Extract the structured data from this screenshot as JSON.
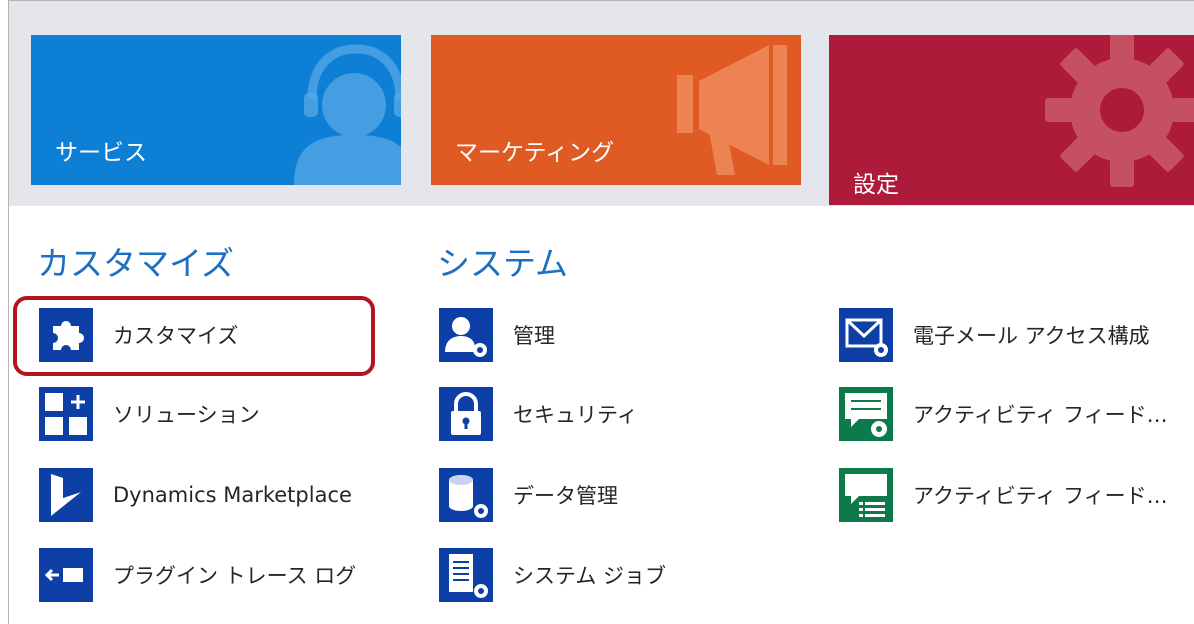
{
  "tiles": [
    {
      "label": "サービス",
      "icon": "headset-person-icon",
      "color": "#0d80d6"
    },
    {
      "label": "マーケティング",
      "icon": "megaphone-icon",
      "color": "#e05a24"
    },
    {
      "label": "設定",
      "icon": "gear-icon",
      "color": "#ae1a3a"
    }
  ],
  "sections": {
    "customize": {
      "title": "カスタマイズ",
      "items": [
        {
          "label": "カスタマイズ",
          "icon": "puzzle-icon",
          "highlighted": true
        },
        {
          "label": "ソリューション",
          "icon": "solution-blocks-icon"
        },
        {
          "label": "Dynamics Marketplace",
          "icon": "dynamics-logo-icon"
        },
        {
          "label": "プラグイン トレース ログ",
          "icon": "plugin-trace-icon"
        }
      ]
    },
    "system": {
      "title": "システム",
      "items": [
        {
          "label": "管理",
          "icon": "admin-user-gear-icon"
        },
        {
          "label": "セキュリティ",
          "icon": "lock-icon"
        },
        {
          "label": "データ管理",
          "icon": "database-gear-icon"
        },
        {
          "label": "システム ジョブ",
          "icon": "document-gear-icon"
        }
      ]
    },
    "system_col2": {
      "items": [
        {
          "label": "電子メール アクセス構成",
          "icon": "email-gear-icon"
        },
        {
          "label": "アクティビティ フィード…",
          "icon": "chat-gear-icon"
        },
        {
          "label": "アクティビティ フィード…",
          "icon": "chat-list-icon"
        }
      ]
    }
  },
  "colors": {
    "accent_blue": "#0e3fa6",
    "feed_green": "#0d7a4b",
    "section_title": "#1c6fc1",
    "highlight_border": "#b5141c"
  }
}
